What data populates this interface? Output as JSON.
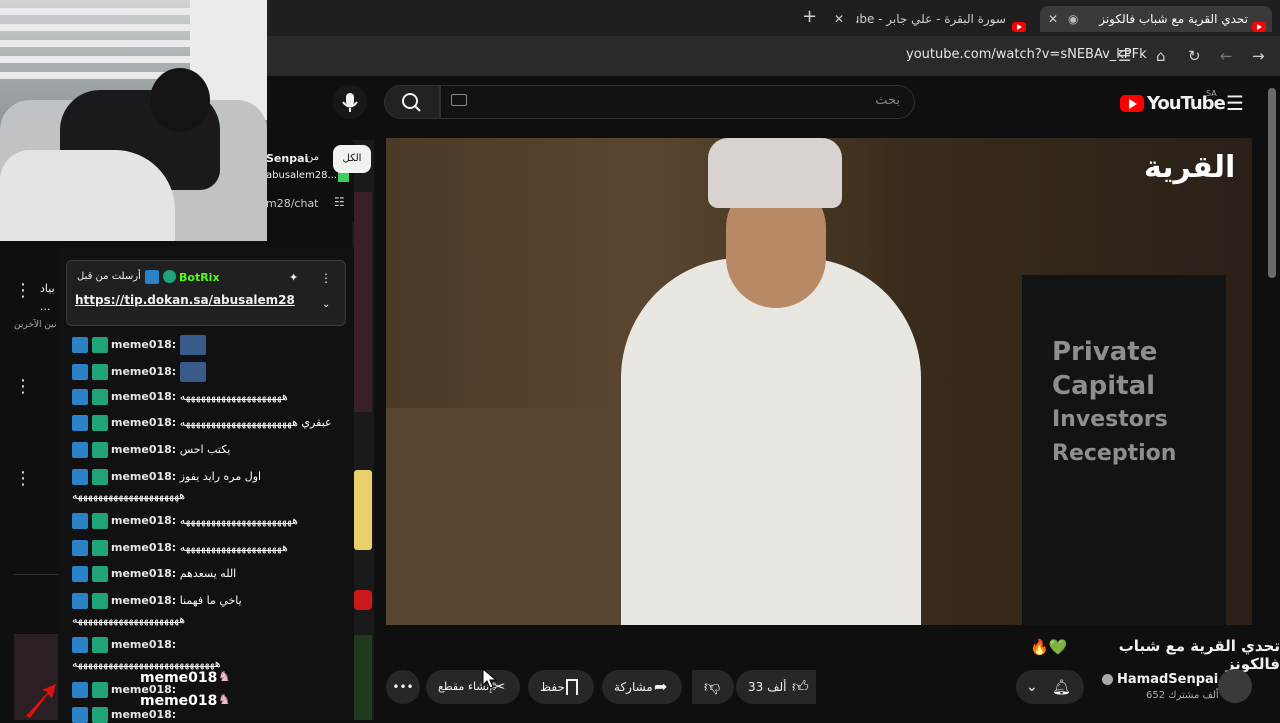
{
  "browser": {
    "tabs": [
      {
        "title": "تحدي القرية مع شباب فالكونز",
        "active": true
      },
      {
        "title": "سورة البقرة - علي جابر - YouTube",
        "active": false
      }
    ],
    "new_tab": "+",
    "close": "✕",
    "url": "youtube.com/watch?v=sNEBAv_kPFk"
  },
  "youtube": {
    "logo_text": "YouTube",
    "region": "SA",
    "search_placeholder": "بحث"
  },
  "sidebar": {
    "snippet_line1": "بياد",
    "snippet_line2": "...",
    "snippet_line3": "نين الآخرين"
  },
  "chat_header": {
    "channel_name": "Senpai",
    "from_label": "من",
    "link_partial": "abusalem28...",
    "chat_path": "m28/chat",
    "all_label": "الكل"
  },
  "pinned": {
    "sender_label": "أرسلت من قبل",
    "author": "BotRix",
    "link": "https://tip.dokan.sa/abusalem28"
  },
  "chat_messages": [
    {
      "user": "meme018:",
      "text": ""
    },
    {
      "user": "meme018:",
      "text": ""
    },
    {
      "user": "meme018:",
      "text": "ههههههههههههههههههههه"
    },
    {
      "user": "meme018:",
      "text": "عبقري ههههههههههههههههههههههه"
    },
    {
      "user": "meme018:",
      "text": "يكتب احس"
    },
    {
      "user": "meme018:",
      "text": "اول مره رايد يفوز",
      "cont": "هههههههههههههههههههههه"
    },
    {
      "user": "meme018:",
      "text": "ههههههههههههههههههههههه"
    },
    {
      "user": "meme018:",
      "text": "ههههههههههههههههههههه"
    },
    {
      "user": "meme018:",
      "text": "الله يسعدهم"
    },
    {
      "user": "meme018:",
      "text": "ياخي ما فهمنا",
      "cont": "هههههههههههههههههههههه"
    },
    {
      "user": "meme018:",
      "text": "",
      "cont": "ههههههههههههههههههههههههههههه"
    },
    {
      "user": "meme018:",
      "text": ""
    },
    {
      "user": "meme018:",
      "text": ""
    }
  ],
  "floating_names": [
    "meme018",
    "meme018"
  ],
  "video": {
    "overlay_title": "القرية",
    "sign_lines": [
      "Private",
      "Capital",
      "Investors",
      "Reception"
    ]
  },
  "below_video": {
    "title": "تحدي القرية مع شباب فالكونز",
    "title_emojis": "🔥💚",
    "channel": "HamadSenpai",
    "subscribers": "652 ألف مشترك",
    "likes": "33 ألف",
    "share": "مشاركة",
    "save": "حفظ",
    "clip": "إنشاء مقطع",
    "more": "•••"
  },
  "colors": {
    "bg": "#0f0f0f",
    "yt_red": "#ff0000",
    "verified_green": "#1fa37a",
    "mod_blue": "#2a82c8"
  }
}
